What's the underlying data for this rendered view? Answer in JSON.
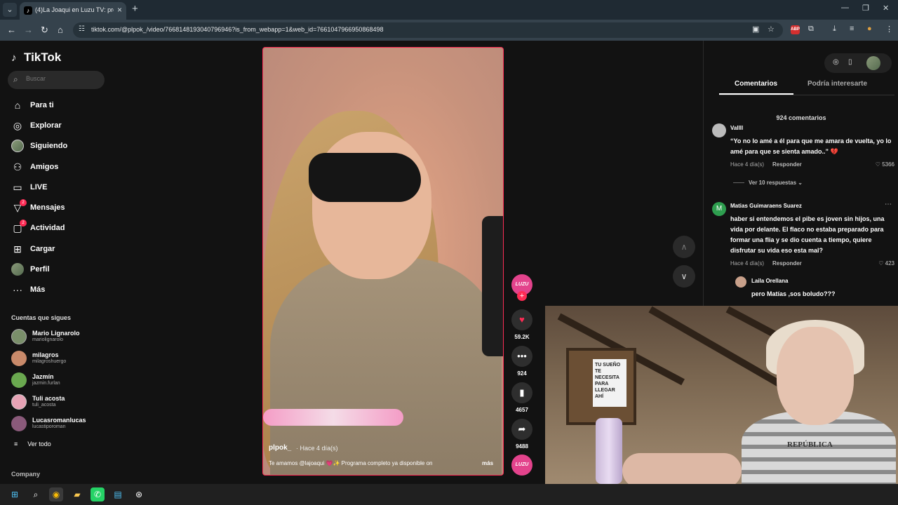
{
  "browser": {
    "tab_title": "(4)La Joaqui en Luzu TV: progra",
    "favicon": "tiktok-icon",
    "url": "tiktok.com/@plpok_/video/7668148193040796946?is_from_webapp=1&web_id=7661047966950868498",
    "extensions": [
      "cast-icon",
      "star-icon",
      "adblock-icon",
      "puzzle-icon",
      "download-icon",
      "playlist-icon",
      "profile-icon",
      "menu-icon"
    ],
    "abp_label": "ABP"
  },
  "sidebar": {
    "logo": "TikTok",
    "search_placeholder": "Buscar",
    "nav": [
      {
        "label": "Para ti",
        "icon": "home-icon"
      },
      {
        "label": "Explorar",
        "icon": "compass-icon"
      },
      {
        "label": "Siguiendo",
        "icon": "following-avatar-icon"
      },
      {
        "label": "Amigos",
        "icon": "friends-icon"
      },
      {
        "label": "LIVE",
        "icon": "live-icon"
      },
      {
        "label": "Mensajes",
        "icon": "messages-icon",
        "badge": "2"
      },
      {
        "label": "Actividad",
        "icon": "activity-icon",
        "badge": "2"
      },
      {
        "label": "Cargar",
        "icon": "upload-icon"
      },
      {
        "label": "Perfil",
        "icon": "profile-avatar-icon"
      },
      {
        "label": "Más",
        "icon": "more-icon"
      }
    ],
    "following_title": "Cuentas que sigues",
    "following": [
      {
        "name": "Mario Lignarolo",
        "handle": "mariolignarolo",
        "color": "#7a8f6a"
      },
      {
        "name": "milagros",
        "handle": "milagroshuergo",
        "color": "#c98a6a"
      },
      {
        "name": "Jazmín",
        "handle": "jazmin.furlan",
        "color": "#6aa84f"
      },
      {
        "name": "Tuli acosta",
        "handle": "tuli_acosta",
        "color": "#e6a3b5"
      },
      {
        "name": "Lucasromanlucas",
        "handle": "lucastiporoman",
        "color": "#8a5a7a"
      }
    ],
    "see_all": "Ver todo",
    "company": "Company"
  },
  "video": {
    "author": "plpok_",
    "time": "· Hace 4 día(s)",
    "caption": "Te amamos @lajoaqui 💗✨ Programa completo ya disponible on",
    "more": "más",
    "channel_badge": "LUZU"
  },
  "actions": {
    "likes": "59.2K",
    "comments": "924",
    "saves": "4657",
    "shares": "9488"
  },
  "comments_panel": {
    "tabs": [
      "Comentarios",
      "Podría interesarte"
    ],
    "count": "924 comentarios",
    "comments": [
      {
        "name": "Vallll",
        "text": "“Yo no lo amé a él para que me amara de vuelta, yo lo amé para que se sienta amado..” 💔",
        "time": "Hace 4 día(s)",
        "reply": "Responder",
        "likes": "5366",
        "avatar_color": "#bbbbbb"
      },
      {
        "name": "Matias Guimaraens Suarez",
        "text": "haber si entendemos el pibe es joven sin hijos, una vida por delante. El flaco no estaba preparado para formar una flia y se dio cuenta a tiempo, quiere disfrutar su vida eso esta mal?",
        "time": "Hace 4 día(s)",
        "reply": "Responder",
        "likes": "423",
        "avatar_letter": "M",
        "avatar_color": "#2e9e4f"
      }
    ],
    "more_replies": "Ver 10 respuestas",
    "reply": {
      "name": "Laila Orellana",
      "text": "pero Matías ,sos boludo???",
      "avatar_color": "#c8a08a"
    }
  },
  "webcam": {
    "poster_text": "TU SUEÑO TE NECESITA PARA LLEGAR AHÍ",
    "shirt_text": "REPÚBLICA"
  },
  "taskbar": [
    "windows-start-icon",
    "search-icon",
    "chrome-icon",
    "file-explorer-icon",
    "whatsapp-icon",
    "notepad-icon",
    "steam-icon"
  ]
}
